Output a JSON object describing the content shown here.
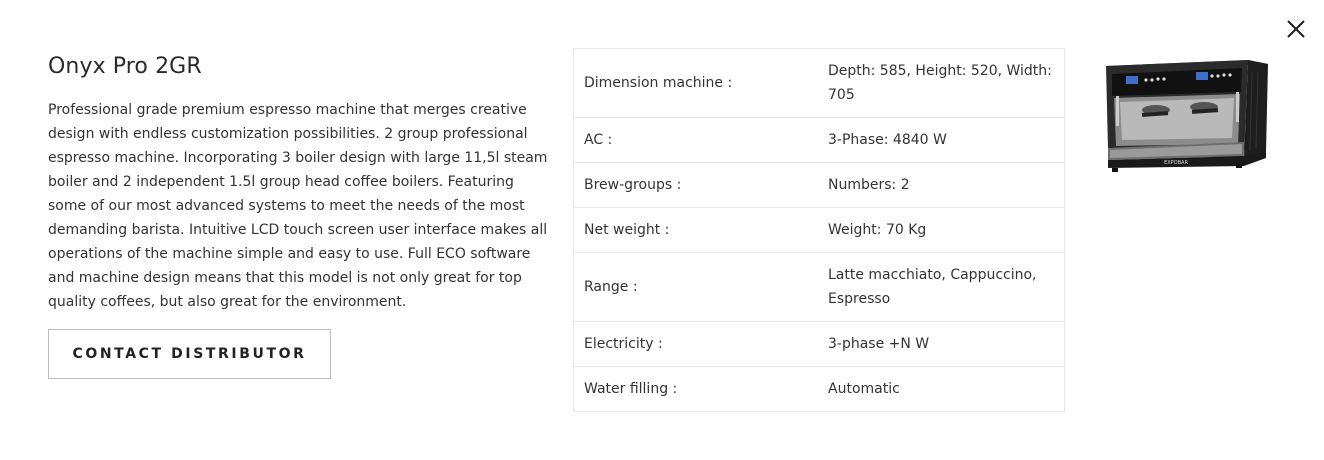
{
  "product": {
    "title": "Onyx Pro 2GR",
    "description": "Professional grade premium espresso machine that merges creative design with endless customization possibilities. 2 group professional espresso machine. Incorporating 3 boiler design with large 11,5l steam boiler and 2 independent 1.5l group head coffee boilers. Featuring some of our most advanced systems to meet the needs of the most demanding barista. Intuitive LCD touch screen user interface makes all operations of the machine simple and easy to use. Full ECO software and machine design means that this model is not only great for top quality coffees, but also great for the environment.",
    "contact_button": "CONTACT DISTRIBUTOR",
    "image_brand_text": "EXPOBAR"
  },
  "specs": [
    {
      "label": "Dimension machine :",
      "value": "Depth: 585, Height: 520, Width: 705"
    },
    {
      "label": "AC :",
      "value": "3-Phase: 4840 W"
    },
    {
      "label": "Brew-groups :",
      "value": "Numbers: 2"
    },
    {
      "label": "Net weight :",
      "value": "Weight: 70 Kg"
    },
    {
      "label": "Range :",
      "value": "Latte macchiato, Cappuccino, Espresso"
    },
    {
      "label": "Electricity :",
      "value": "3-phase +N W"
    },
    {
      "label": "Water filling :",
      "value": "Automatic"
    }
  ],
  "icons": {
    "close": "close-icon"
  }
}
